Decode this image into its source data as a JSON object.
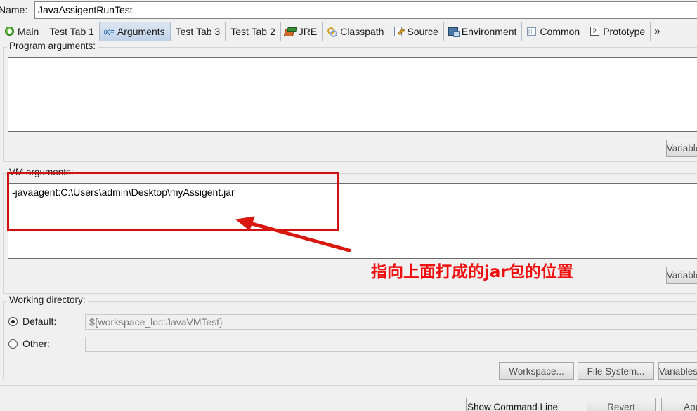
{
  "dialog": {
    "name_label": "Name:",
    "name_value": "JavaAssigentRunTest"
  },
  "tabs": [
    {
      "label": "Main",
      "icon": "java-launch-icon",
      "selected": false
    },
    {
      "label": "Test Tab 1",
      "icon": "none",
      "selected": false
    },
    {
      "label": "Arguments",
      "icon": "variable-icon",
      "selected": true
    },
    {
      "label": "Test Tab 3",
      "icon": "none",
      "selected": false
    },
    {
      "label": "Test Tab 2",
      "icon": "none",
      "selected": false
    },
    {
      "label": "JRE",
      "icon": "jre-icon",
      "selected": false
    },
    {
      "label": "Classpath",
      "icon": "classpath-icon",
      "selected": false
    },
    {
      "label": "Source",
      "icon": "source-icon",
      "selected": false
    },
    {
      "label": "Environment",
      "icon": "environment-icon",
      "selected": false
    },
    {
      "label": "Common",
      "icon": "common-icon",
      "selected": false
    },
    {
      "label": "Prototype",
      "icon": "prototype-icon",
      "selected": false
    }
  ],
  "tabs_overflow_label": "»",
  "program_arguments": {
    "label": "Program arguments:",
    "value": "",
    "variables_button": "Variables..."
  },
  "vm_arguments": {
    "label": "VM arguments:",
    "value": "-javaagent:C:\\Users\\admin\\Desktop\\myAssigent.jar",
    "variables_button": "Variables..."
  },
  "working_directory": {
    "label": "Working directory:",
    "default_radio_label": "Default:",
    "default_value": "${workspace_loc:JavaVMTest}",
    "default_selected": true,
    "other_radio_label": "Other:",
    "other_value": "",
    "other_selected": false,
    "buttons": [
      {
        "label": "Workspace...",
        "enabled": false
      },
      {
        "label": "File System...",
        "enabled": false
      },
      {
        "label": "Variables...",
        "enabled": false
      }
    ]
  },
  "footer": {
    "buttons": [
      {
        "label": "Show Command Line",
        "enabled": true
      },
      {
        "label": "Revert",
        "enabled": false
      },
      {
        "label": "Apply",
        "enabled": false
      }
    ]
  },
  "annotations": {
    "callout_text": "指向上面打成的jar包的位置",
    "box_color": "#d21010",
    "arrow_color": "#d8180f"
  }
}
